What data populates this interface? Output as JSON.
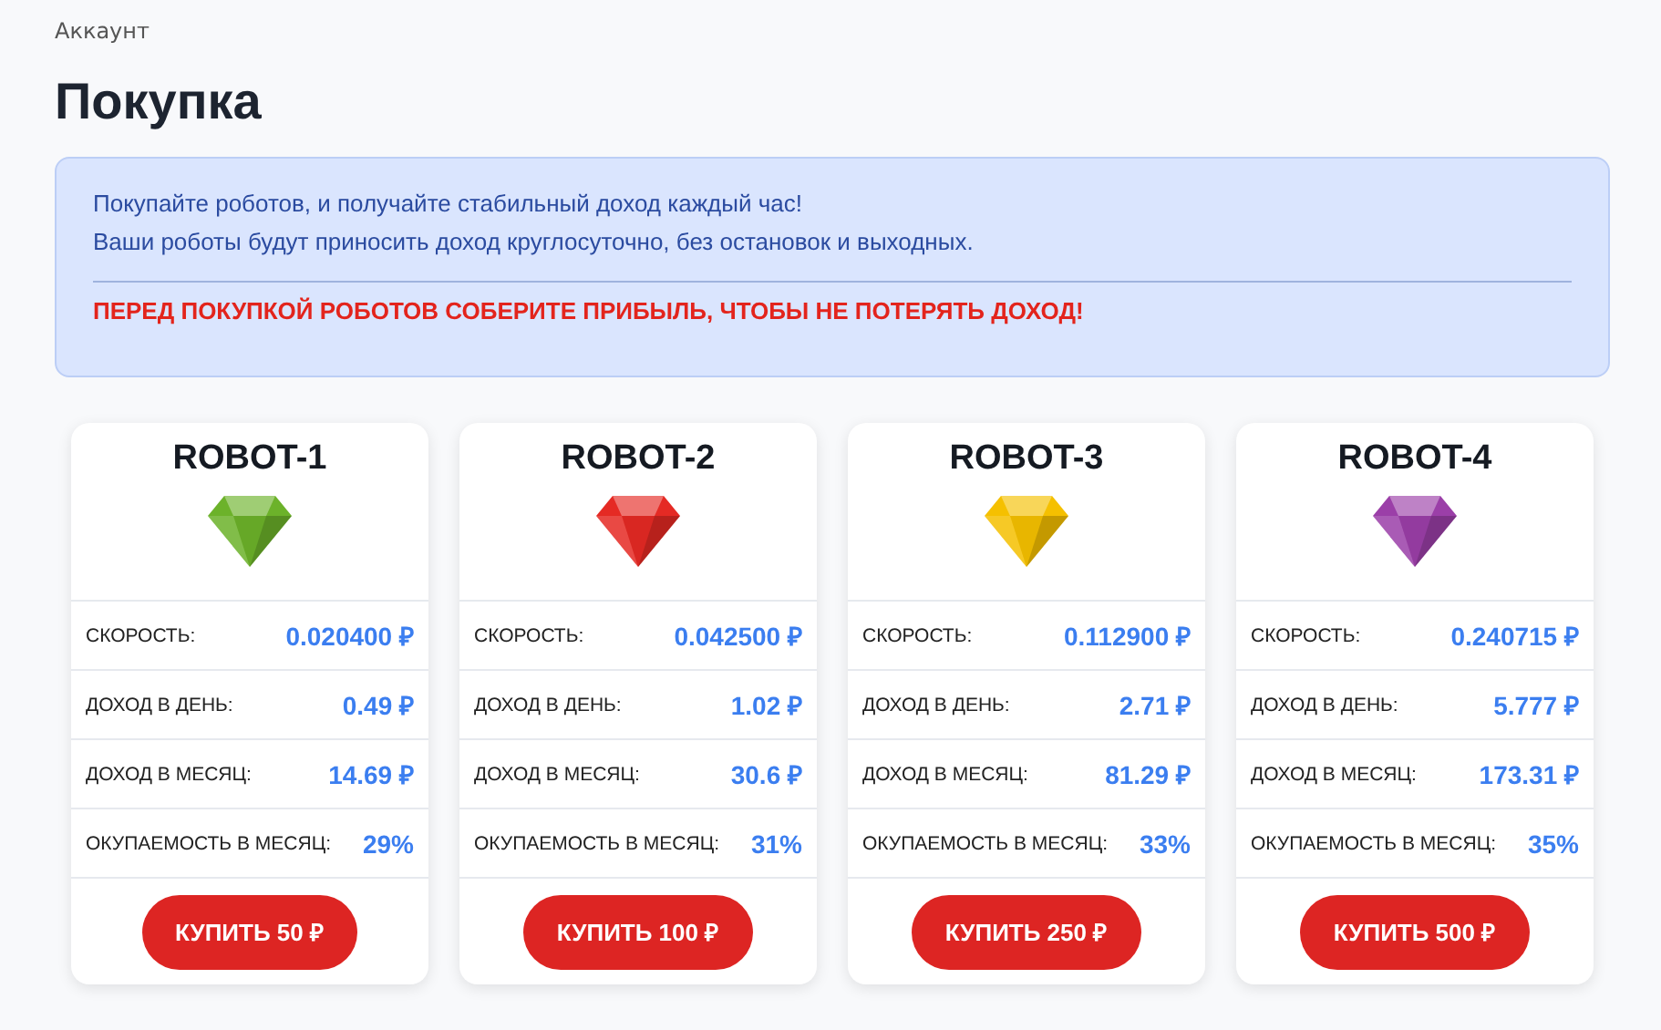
{
  "breadcrumb": "Аккаунт",
  "title": "Покупка",
  "info": {
    "lines": [
      "Покупайте роботов, и получайте стабильный доход каждый час!",
      "Ваши роботы будут приносить доход круглосуточно, без остановок и выходных."
    ],
    "warning": "ПЕРЕД ПОКУПКОЙ РОБОТОВ СОБЕРИТЕ ПРИБЫЛЬ, ЧТОБЫ НЕ ПОТЕРЯТЬ ДОХОД!"
  },
  "robots": [
    {
      "name": "ROBOT-1",
      "color": "#6cb22a",
      "stats": [
        {
          "label": "СКОРОСТЬ:",
          "value": "0.020400 ₽"
        },
        {
          "label": "ДОХОД В ДЕНЬ:",
          "value": "0.49 ₽"
        },
        {
          "label": "ДОХОД В МЕСЯЦ:",
          "value": "14.69 ₽"
        },
        {
          "label": "ОКУПАЕМОСТЬ В МЕСЯЦ:",
          "value": "29%"
        }
      ],
      "button": "КУПИТЬ 50 ₽"
    },
    {
      "name": "ROBOT-2",
      "color": "#e52a24",
      "stats": [
        {
          "label": "СКОРОСТЬ:",
          "value": "0.042500 ₽"
        },
        {
          "label": "ДОХОД В ДЕНЬ:",
          "value": "1.02 ₽"
        },
        {
          "label": "ДОХОД В МЕСЯЦ:",
          "value": "30.6 ₽"
        },
        {
          "label": "ОКУПАЕМОСТЬ В МЕСЯЦ:",
          "value": "31%"
        }
      ],
      "button": "КУПИТЬ 100 ₽"
    },
    {
      "name": "ROBOT-3",
      "color": "#f5c000",
      "stats": [
        {
          "label": "СКОРОСТЬ:",
          "value": "0.112900 ₽"
        },
        {
          "label": "ДОХОД В ДЕНЬ:",
          "value": "2.71 ₽"
        },
        {
          "label": "ДОХОД В МЕСЯЦ:",
          "value": "81.29 ₽"
        },
        {
          "label": "ОКУПАЕМОСТЬ В МЕСЯЦ:",
          "value": "33%"
        }
      ],
      "button": "КУПИТЬ 250 ₽"
    },
    {
      "name": "ROBOT-4",
      "color": "#9b3fa8",
      "stats": [
        {
          "label": "СКОРОСТЬ:",
          "value": "0.240715 ₽"
        },
        {
          "label": "ДОХОД В ДЕНЬ:",
          "value": "5.777 ₽"
        },
        {
          "label": "ДОХОД В МЕСЯЦ:",
          "value": "173.31 ₽"
        },
        {
          "label": "ОКУПАЕМОСТЬ В МЕСЯЦ:",
          "value": "35%"
        }
      ],
      "button": "КУПИТЬ 500 ₽"
    }
  ]
}
